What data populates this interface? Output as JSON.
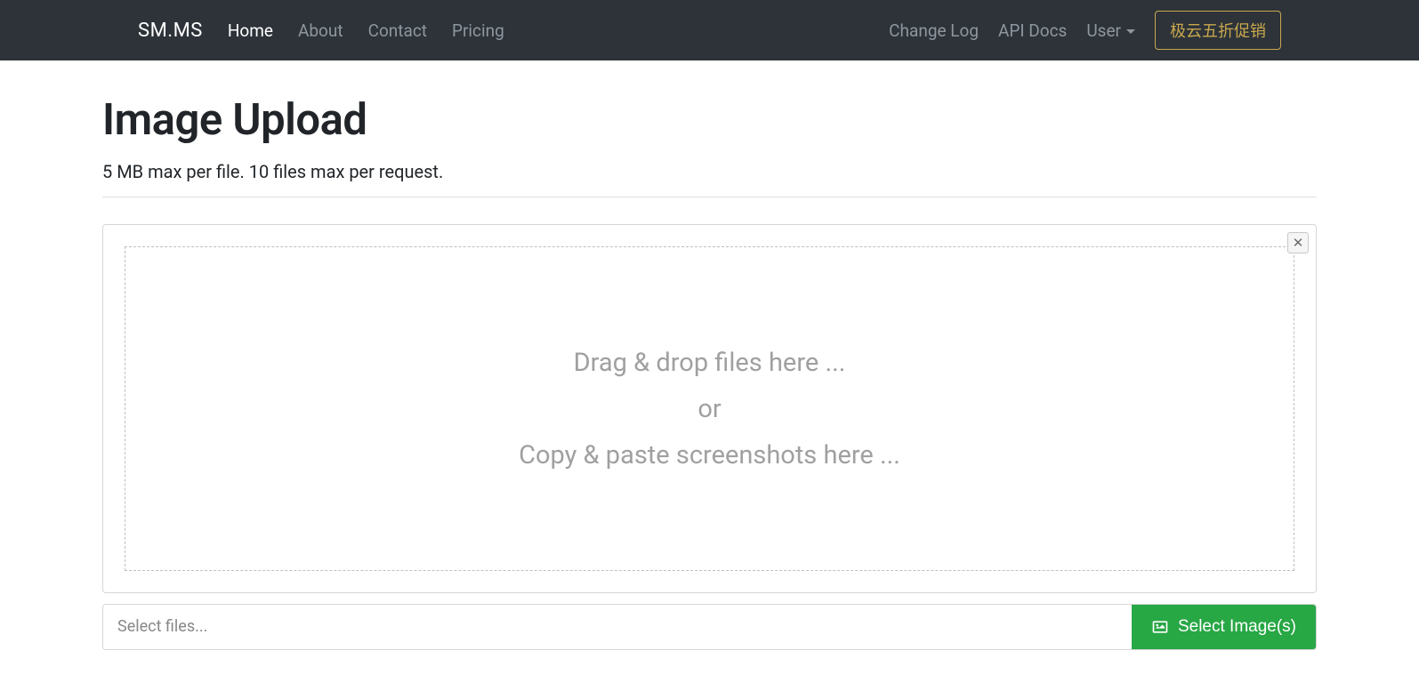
{
  "nav": {
    "brand": "SM.MS",
    "items": [
      {
        "label": "Home",
        "active": true
      },
      {
        "label": "About",
        "active": false
      },
      {
        "label": "Contact",
        "active": false
      },
      {
        "label": "Pricing",
        "active": false
      }
    ],
    "right_items": [
      {
        "label": "Change Log"
      },
      {
        "label": "API Docs"
      }
    ],
    "user_label": "User",
    "promo_label": "极云五折促销"
  },
  "page": {
    "title": "Image Upload",
    "subtitle": "5 MB max per file. 10 files max per request."
  },
  "dropzone": {
    "line1": "Drag & drop files here ...",
    "line2": "or",
    "line3": "Copy & paste screenshots here ..."
  },
  "file_input": {
    "placeholder": "Select files...",
    "button_label": "Select Image(s)"
  }
}
